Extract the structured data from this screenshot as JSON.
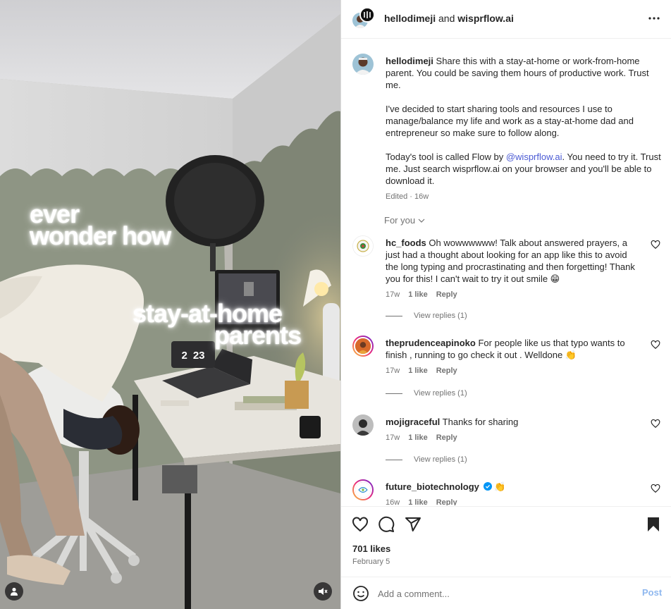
{
  "media": {
    "overlay_line1": "ever",
    "overlay_line2": "wonder how",
    "overlay_line3": "stay-at-home",
    "overlay_line4": "parents",
    "clock_hour": "2",
    "clock_minutes": "23",
    "icons": [
      "user-tag-icon",
      "mute-icon"
    ]
  },
  "header": {
    "user1": "hellodimeji",
    "connector": " and ",
    "user2": "wisprflow.ai",
    "more_icon": "more-horizontal-icon"
  },
  "caption": {
    "username": "hellodimeji",
    "para1": " Share this with a stay-at-home or work-from-home parent. You could be saving them hours of productive work. Trust me.",
    "para2": "I've decided to start sharing tools and resources I use to manage/balance my life and work as a stay-at-home dad and entrepreneur so make sure to follow along.",
    "para3_before": "Today's tool is called Flow by ",
    "para3_mention": "@wisprflow.ai",
    "para3_after": ". You need to try it. Trust me. Just search wisprflow.ai on your browser and you'll be able to download it.",
    "meta": "Edited · 16w"
  },
  "for_you": "For you",
  "comments": [
    {
      "username": "hc_foods",
      "text": " Oh wowwwwww! Talk about answered prayers, a just had a thought about looking for an app like this to avoid the long typing and procrastinating and then forgetting! Thank you for this! I can't wait to try it out smile 😁",
      "age": "17w",
      "likes": "1 like",
      "reply": "Reply",
      "view_replies": "View replies (1)"
    },
    {
      "username": "theprudenceapinoko",
      "text": " For people like us that typo wants to finish , running to go check it out . Welldone 👏",
      "age": "17w",
      "likes": "1 like",
      "reply": "Reply",
      "view_replies": "View replies (1)"
    },
    {
      "username": "mojigraceful",
      "text": " Thanks for sharing",
      "age": "17w",
      "likes": "1 like",
      "reply": "Reply",
      "view_replies": "View replies (1)"
    },
    {
      "username": "future_biotechnology",
      "text": " 👏",
      "age": "16w",
      "likes": "1 like",
      "reply": "Reply"
    }
  ],
  "actions": {
    "likes": "701 likes",
    "date": "February 5",
    "icons": [
      "heart-icon",
      "comment-icon",
      "share-icon",
      "bookmark-icon"
    ]
  },
  "add_comment": {
    "placeholder": "Add a comment...",
    "post_label": "Post"
  },
  "colors": {
    "accent_link": "#4a5ad4",
    "post_disabled": "#8fb8ef",
    "verified": "#0095f6"
  }
}
